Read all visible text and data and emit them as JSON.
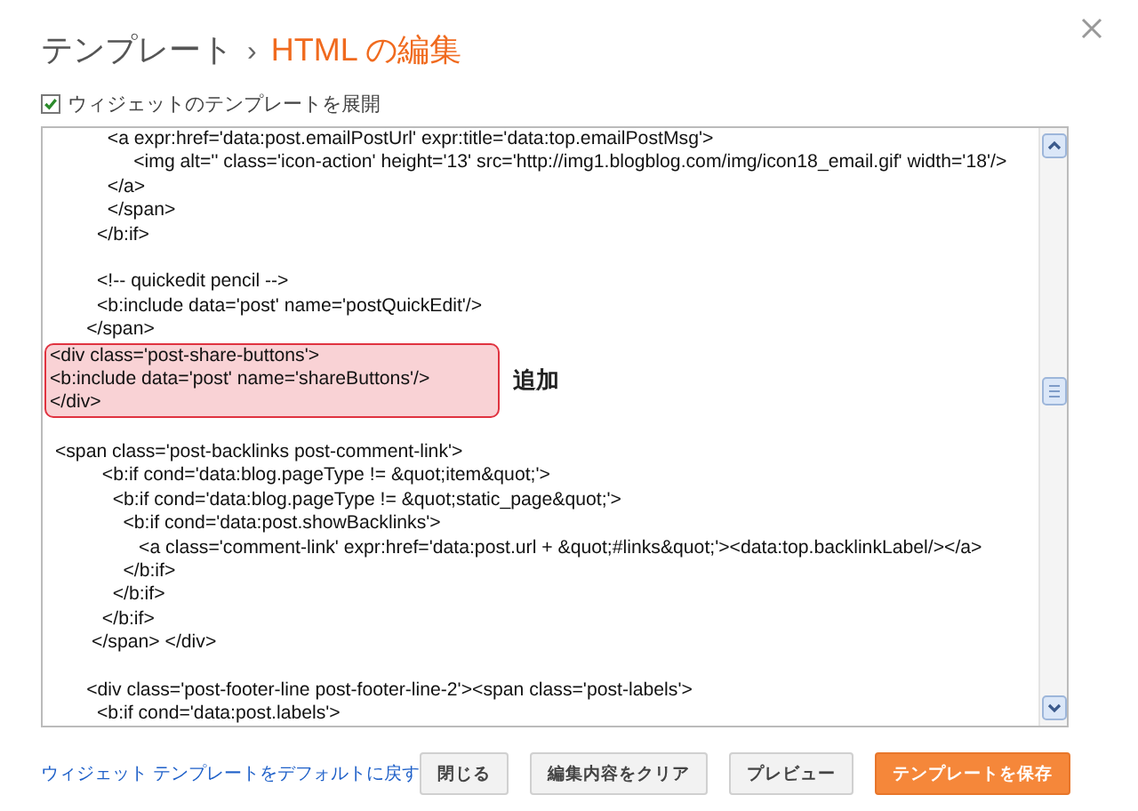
{
  "dialog": {
    "title": {
      "parent": "テンプレート",
      "separator": "›",
      "current": "HTML の編集"
    }
  },
  "expand_option": {
    "label": "ウィジェットのテンプレートを展開",
    "checked": true
  },
  "editor": {
    "blocks": [
      {
        "kind": "plain",
        "lines": [
          "           <a expr:href='data:post.emailPostUrl' expr:title='data:top.emailPostMsg'>",
          "                <img alt='' class='icon-action' height='13' src='http://img1.blogblog.com/img/icon18_email.gif' width='18'/>",
          "           </a>",
          "           </span>",
          "         </b:if>"
        ]
      },
      {
        "kind": "blank"
      },
      {
        "kind": "plain",
        "lines": [
          "         <!-- quickedit pencil -->",
          "         <b:include data='post' name='postQuickEdit'/>",
          "       </span>"
        ]
      },
      {
        "kind": "highlight",
        "note": "追加",
        "lines": [
          "<div class='post-share-buttons'>",
          "<b:include data='post' name='shareButtons'/>",
          "</div>"
        ]
      },
      {
        "kind": "blank"
      },
      {
        "kind": "plain",
        "lines": [
          " <span class='post-backlinks post-comment-link'>",
          "          <b:if cond='data:blog.pageType != &quot;item&quot;'>",
          "            <b:if cond='data:blog.pageType != &quot;static_page&quot;'>",
          "              <b:if cond='data:post.showBacklinks'>",
          "                 <a class='comment-link' expr:href='data:post.url + &quot;#links&quot;'><data:top.backlinkLabel/></a>",
          "              </b:if>",
          "            </b:if>",
          "          </b:if>",
          "        </span> </div>"
        ]
      },
      {
        "kind": "blank"
      },
      {
        "kind": "plain",
        "lines": [
          "       <div class='post-footer-line post-footer-line-2'><span class='post-labels'>",
          "         <b:if cond='data:post.labels'>"
        ]
      }
    ]
  },
  "footer": {
    "link": "ウィジェット テンプレートをデフォルトに戻す",
    "buttons": [
      {
        "label": "閉じる",
        "kind": "plain"
      },
      {
        "label": "編集内容をクリア",
        "kind": "plain"
      },
      {
        "label": "プレビュー",
        "kind": "plain"
      },
      {
        "label": "テンプレートを保存",
        "kind": "primary"
      }
    ]
  }
}
